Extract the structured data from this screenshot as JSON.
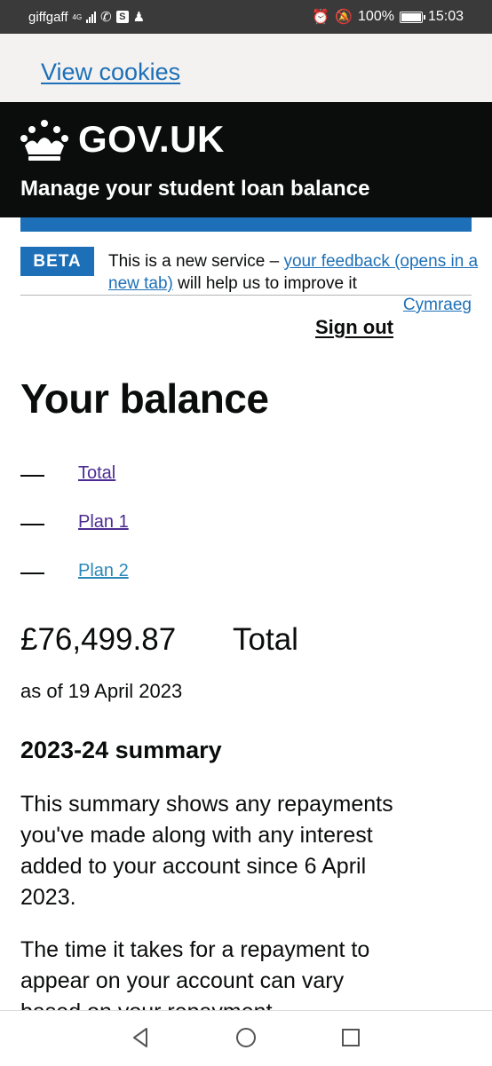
{
  "status_bar": {
    "carrier": "giffgaff",
    "network": "4G",
    "battery_percent": "100%",
    "time": "15:03",
    "icons": [
      "signal-icon",
      "whatsapp-icon",
      "s-app-icon",
      "add-contact-icon",
      "alarm-icon",
      "mute-icon",
      "battery-icon"
    ]
  },
  "cookie_banner": {
    "link": "View cookies"
  },
  "header": {
    "logo": "GOV.UK",
    "service_name": "Manage your student loan balance"
  },
  "phase_banner": {
    "tag": "BETA",
    "text_before": "This is a new service – ",
    "link": "your feedback (opens in a new tab)",
    "text_after": " will help us to improve it"
  },
  "language_link": "Cymraeg",
  "sign_out": "Sign out",
  "page_title": "Your balance",
  "contents": [
    {
      "label": "Total"
    },
    {
      "label": "Plan 1"
    },
    {
      "label": "Plan 2"
    }
  ],
  "balance": {
    "amount": "£76,499.87",
    "label": "Total",
    "as_of": "as of 19 April 2023"
  },
  "summary": {
    "heading": "2023-24 summary",
    "paragraph1": "This summary shows any repayments you've made along with any interest added to your account since 6 April 2023.",
    "paragraph2": "The time it takes for a repayment to appear on your account can vary based on your repayment"
  },
  "colors": {
    "govuk_black": "#0b0c0c",
    "govuk_blue": "#1d70b8",
    "visited_link": "#4c2c92",
    "light_grey": "#f3f2f1"
  }
}
